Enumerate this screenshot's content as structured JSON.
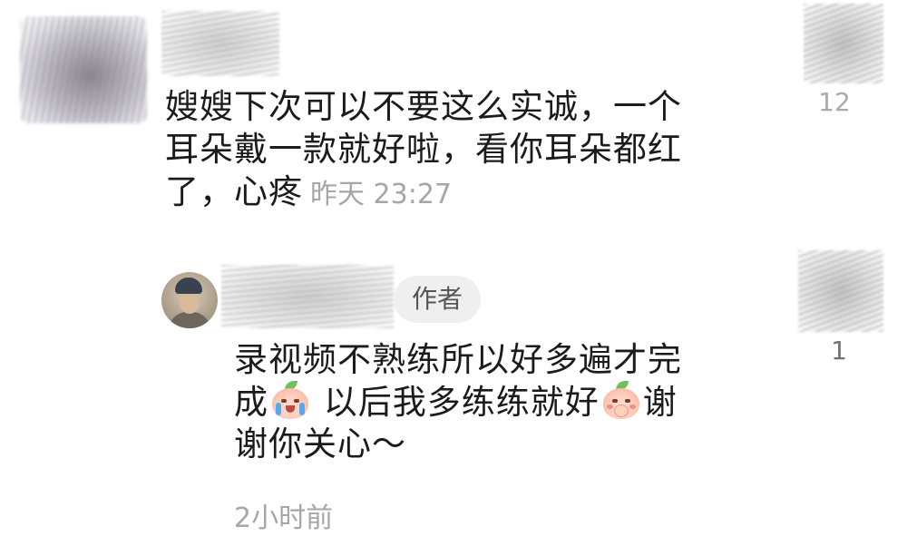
{
  "top_comment": {
    "text_line1": "嫂嫂下次可以不要这么实诚，一个",
    "text_line2": "耳朵戴一款就好啦，看你耳朵都红",
    "text_line3": "了，心疼",
    "time": "昨天 23:27",
    "like_count": "12"
  },
  "reply": {
    "badge": "作者",
    "text_part1": "录视频不熟练所以好多遍才完",
    "text_part2": "成",
    "text_part3": "以后我多练练就好",
    "text_part4": "谢",
    "text_part5": "谢你关心～",
    "time": "2小时前",
    "like_count": "1",
    "emoji_1": "crying-peach-emoji",
    "emoji_2": "shy-peach-emoji"
  },
  "colors": {
    "text": "#1b1b1b",
    "meta": "#a6a6a6",
    "badge_bg": "#efefef",
    "badge_text": "#555555"
  }
}
